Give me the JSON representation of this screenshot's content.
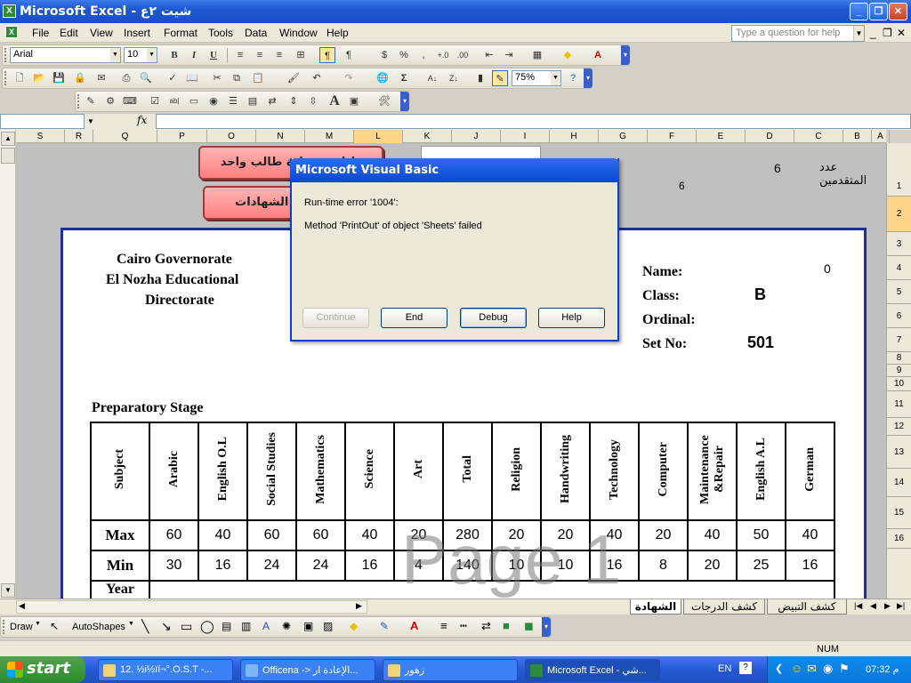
{
  "window": {
    "title": "Microsoft Excel - شيت ٢ع",
    "logo": "X"
  },
  "menu": [
    "File",
    "Edit",
    "View",
    "Insert",
    "Format",
    "Tools",
    "Data",
    "Window",
    "Help"
  ],
  "help_placeholder": "Type a question for help",
  "format_toolbar": {
    "font": "Arial",
    "size": "10"
  },
  "standard_toolbar": {
    "zoom": "75%"
  },
  "formula_bar": {
    "fx": "fx"
  },
  "columns": [
    "S",
    "R",
    "Q",
    "P",
    "O",
    "N",
    "M",
    "L",
    "K",
    "J",
    "I",
    "H",
    "G",
    "F",
    "E",
    "D",
    "C",
    "B",
    "A"
  ],
  "rows": [
    "1",
    "2",
    "3",
    "4",
    "5",
    "6",
    "7",
    "8",
    "9",
    "10",
    "11",
    "12",
    "13",
    "14",
    "15",
    "16"
  ],
  "sheet": {
    "buttons": {
      "top": "طباعة شهادة طالب واحد",
      "bottom": "طباعة كل الشهادات"
    },
    "applicants_label": "عدد المتقدمين",
    "applicants_value": "6",
    "six_value": "6",
    "org": [
      "Cairo Governorate",
      "El Nozha Educational",
      "Directorate"
    ],
    "fields": {
      "name_label": "Name:",
      "name_value": "0",
      "class_label": "Class:",
      "class_value": "B",
      "ordinal_label": "Ordinal:",
      "setno_label": "Set No:",
      "setno_value": "501"
    },
    "stage": "Preparatory  Stage",
    "subjects": [
      "Subject",
      "Arabic",
      "English O.L",
      "Social Studies",
      "Mathematics",
      "Science",
      "Art",
      "Total",
      "Religion",
      "Handwriting",
      "Technology",
      "Computer",
      "Maintenance &Repair",
      "English A.L",
      "German"
    ],
    "max_row": [
      "Max",
      "60",
      "40",
      "60",
      "60",
      "40",
      "20",
      "280",
      "20",
      "20",
      "40",
      "20",
      "40",
      "50",
      "40"
    ],
    "min_row": [
      "Min",
      "30",
      "16",
      "24",
      "24",
      "16",
      "4",
      "140",
      "10",
      "10",
      "16",
      "8",
      "20",
      "25",
      "16"
    ],
    "year_label": "Year",
    "watermark": "Page 1"
  },
  "dialog": {
    "title": "Microsoft Visual Basic",
    "line1": "Run-time error '1004':",
    "line2": "Method 'PrintOut' of object 'Sheets' failed",
    "buttons": [
      "Continue",
      "End",
      "Debug",
      "Help"
    ]
  },
  "sheet_tabs": [
    "الشهادة",
    "كشف الدرجات",
    "كشف التبيض"
  ],
  "draw_toolbar": {
    "draw": "Draw",
    "autoshapes": "AutoShapes"
  },
  "status": {
    "num": "NUM"
  },
  "taskbar": {
    "start": "start",
    "tasks": [
      "12. ½i½ïí¬°.O.S.T -...",
      "Officena -> الإعادة ار...",
      "زهور",
      "Microsoft Excel - شي..."
    ],
    "lang": "EN",
    "clock": "07:32 م"
  },
  "colors": {
    "accent": "#1c2fa0",
    "button_fill": "#ff8f8f",
    "title_bar": "#1d58d0"
  }
}
